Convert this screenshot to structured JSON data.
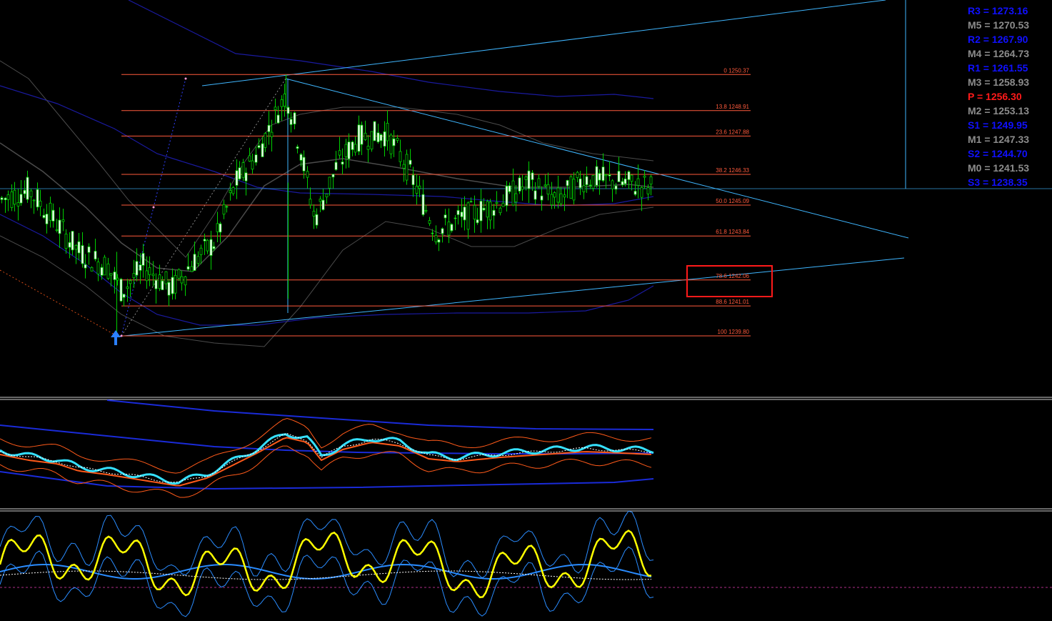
{
  "chart_data": {
    "type": "candlestick",
    "panes": [
      "price",
      "oscillator-1",
      "oscillator-2"
    ],
    "fib_levels": [
      {
        "label": "0 1250.37",
        "value": 1250.37
      },
      {
        "label": "13.8 1248.91",
        "value": 1248.91
      },
      {
        "label": "23.6 1247.88",
        "value": 1247.88
      },
      {
        "label": "38.2 1246.33",
        "value": 1246.33
      },
      {
        "label": "50.0 1245.09",
        "value": 1245.09
      },
      {
        "label": "61.8 1243.84",
        "value": 1243.84
      },
      {
        "label": "78.6 1242.06",
        "value": 1242.06
      },
      {
        "label": "88.6 1241.01",
        "value": 1241.01
      },
      {
        "label": "100 1239.80",
        "value": 1239.8
      }
    ],
    "pivots": [
      {
        "label": "R3 = 1273.16",
        "value": 1273.16,
        "color": "#1010ff"
      },
      {
        "label": "M5 = 1270.53",
        "value": 1270.53,
        "color": "#8c8c8c"
      },
      {
        "label": "R2 = 1267.90",
        "value": 1267.9,
        "color": "#1010ff"
      },
      {
        "label": "M4 = 1264.73",
        "value": 1264.73,
        "color": "#8c8c8c"
      },
      {
        "label": "R1 = 1261.55",
        "value": 1261.55,
        "color": "#1010ff"
      },
      {
        "label": "M3 = 1258.93",
        "value": 1258.93,
        "color": "#8c8c8c"
      },
      {
        "label": "P  = 1256.30",
        "value": 1256.3,
        "color": "#ff1a1a"
      },
      {
        "label": "M2 = 1253.13",
        "value": 1253.13,
        "color": "#8c8c8c"
      },
      {
        "label": "S1 = 1249.95",
        "value": 1249.95,
        "color": "#1010ff"
      },
      {
        "label": "M1 = 1247.33",
        "value": 1247.33,
        "color": "#8c8c8c"
      },
      {
        "label": "S2 = 1244.70",
        "value": 1244.7,
        "color": "#1010ff"
      },
      {
        "label": "M0 = 1241.53",
        "value": 1241.53,
        "color": "#8c8c8c"
      },
      {
        "label": "S3 = 1238.35",
        "value": 1238.35,
        "color": "#1010ff"
      }
    ],
    "current_price": 1245.75,
    "highlight_level": 1242.06,
    "colors": {
      "fib": "#ff5a3c",
      "trend": "#3fb6ff",
      "candle": "#00d000",
      "candle_bull_body": "#ffffff",
      "bands_outer": "#1a1aa0",
      "bands_gray": "#4b4b4b",
      "osc_fast": "#35e0ff",
      "osc_slow": "#ff5a1a",
      "osc_band": "#1a2bd8",
      "stoch": "#ffff00",
      "stoch_signal": "#2a8cff",
      "highlight_box": "#ff1a1a"
    }
  }
}
